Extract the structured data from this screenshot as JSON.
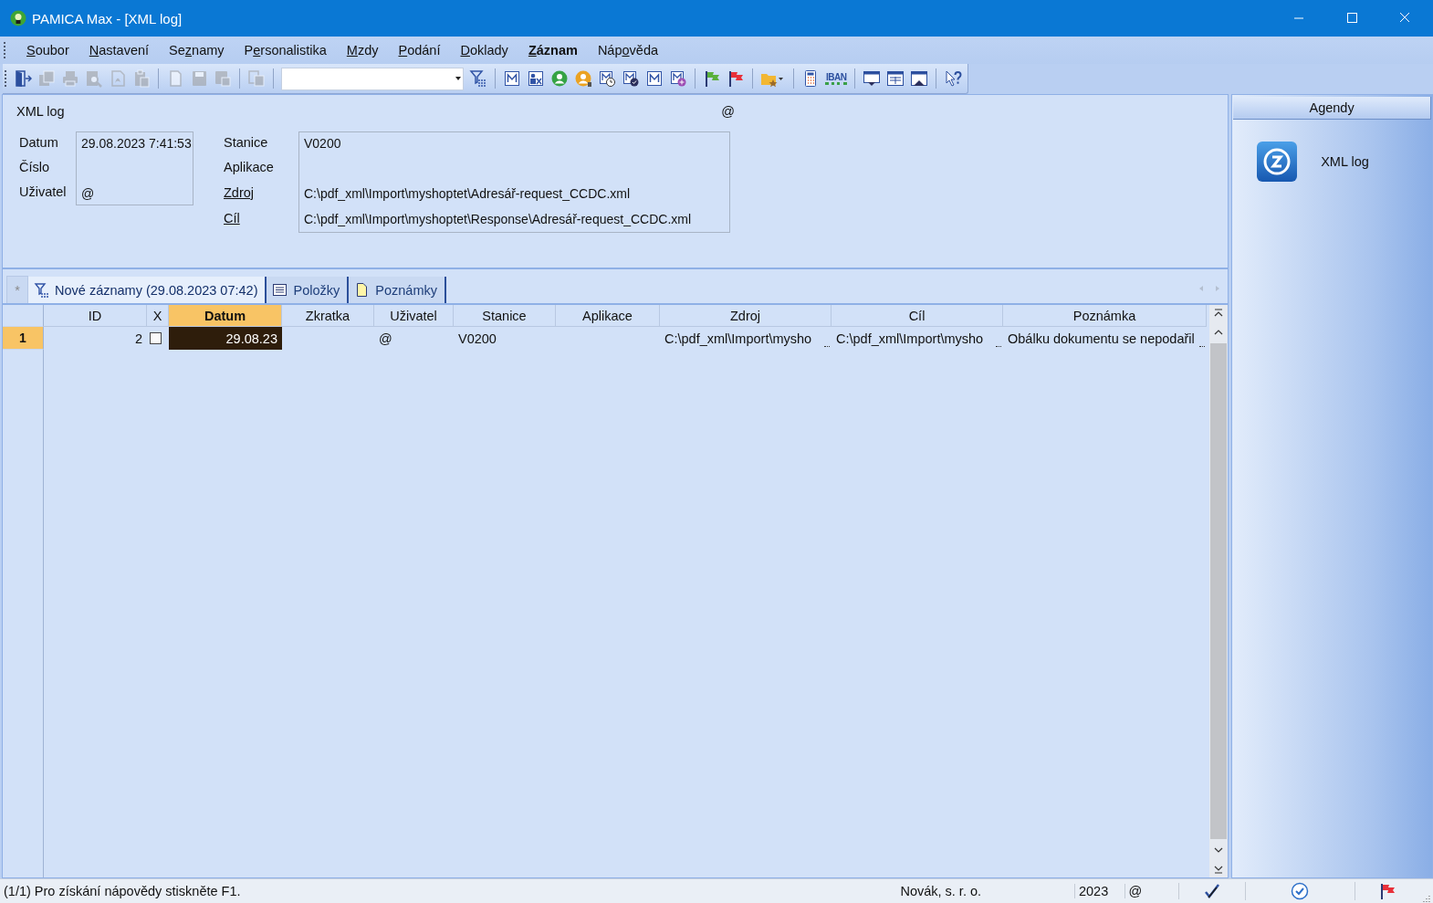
{
  "window": {
    "title": "PAMICA Max - [XML log]"
  },
  "menu": [
    {
      "key": "S",
      "post": "oubor",
      "emphasized": false
    },
    {
      "key": "N",
      "post": "astavení",
      "emphasized": false
    },
    {
      "pre": "Se",
      "key": "z",
      "post": "namy",
      "emphasized": false
    },
    {
      "pre": "P",
      "key": "e",
      "post": "rsonalistika",
      "emphasized": false
    },
    {
      "key": "M",
      "post": "zdy",
      "emphasized": false
    },
    {
      "key": "P",
      "post": "odání",
      "emphasized": false
    },
    {
      "key": "D",
      "post": "oklady",
      "emphasized": false
    },
    {
      "key": "Z",
      "post": "áznam",
      "emphasized": true
    },
    {
      "pre": "Náp",
      "key": "o",
      "post": "věda",
      "emphasized": false
    }
  ],
  "toolbar": [
    {
      "kind": "door",
      "disabled": false
    },
    {
      "kind": "copy",
      "disabled": true
    },
    {
      "kind": "printer",
      "disabled": true
    },
    {
      "kind": "preview",
      "disabled": true
    },
    {
      "kind": "pdf",
      "disabled": true
    },
    {
      "kind": "paste",
      "disabled": true
    },
    {
      "kind": "separator"
    },
    {
      "kind": "page",
      "disabled": true
    },
    {
      "kind": "save",
      "disabled": true
    },
    {
      "kind": "save-copy",
      "disabled": true
    },
    {
      "kind": "separator"
    },
    {
      "kind": "duplicate",
      "disabled": true
    },
    {
      "kind": "separator"
    },
    {
      "kind": "combo"
    },
    {
      "kind": "filter",
      "disabled": false
    },
    {
      "kind": "separator"
    },
    {
      "kind": "m",
      "disabled": false
    },
    {
      "kind": "person-x",
      "disabled": false
    },
    {
      "kind": "person-green",
      "disabled": false
    },
    {
      "kind": "person-orange",
      "disabled": false
    },
    {
      "kind": "m-clock",
      "disabled": false
    },
    {
      "kind": "m-check",
      "disabled": false
    },
    {
      "kind": "m",
      "disabled": false
    },
    {
      "kind": "m-plus",
      "disabled": false
    },
    {
      "kind": "separator"
    },
    {
      "kind": "flag-green",
      "disabled": false
    },
    {
      "kind": "flag-red",
      "disabled": false
    },
    {
      "kind": "separator"
    },
    {
      "kind": "folder-star",
      "disabled": false
    },
    {
      "kind": "separator"
    },
    {
      "kind": "calculator",
      "disabled": false
    },
    {
      "kind": "iban",
      "label": "IBAN",
      "disabled": false
    },
    {
      "kind": "separator"
    },
    {
      "kind": "window-down",
      "disabled": false
    },
    {
      "kind": "window",
      "disabled": false
    },
    {
      "kind": "window-up",
      "disabled": false
    },
    {
      "kind": "separator"
    },
    {
      "kind": "help",
      "disabled": false
    }
  ],
  "record": {
    "title": "XML log",
    "user_mark": "@",
    "left_fields": [
      {
        "label": "Datum",
        "value": "29.08.2023 7:41:53"
      },
      {
        "label": "Číslo"
      },
      {
        "label": "Uživatel",
        "value": "@"
      }
    ],
    "right_fields": [
      {
        "label": "Stanice",
        "value": "V0200",
        "link": false
      },
      {
        "label": "Aplikace",
        "link": false
      },
      {
        "label": "Zdroj",
        "value": "C:\\pdf_xml\\Import\\myshoptet\\Adresář-request_CCDC.xml",
        "link": true
      },
      {
        "label": "Cíl",
        "value": "C:\\pdf_xml\\Import\\myshoptet\\Response\\Adresář-request_CCDC.xml",
        "link": true
      }
    ]
  },
  "tabs": [
    {
      "kind": "new",
      "label": "*",
      "selected": false
    },
    {
      "kind": "filter",
      "label": "Nové záznamy (29.08.2023 07:42)",
      "selected": true
    },
    {
      "kind": "list",
      "label": "Položky",
      "selected": false
    },
    {
      "kind": "note",
      "label": "Poznámky",
      "selected": false
    }
  ],
  "table": {
    "columns": [
      {
        "label": "ID",
        "kind": "number",
        "selected": false
      },
      {
        "label": "X",
        "kind": "check",
        "selected": false
      },
      {
        "label": "Datum",
        "kind": "number",
        "selected": true
      },
      {
        "label": "Zkratka",
        "kind": "text",
        "selected": false
      },
      {
        "label": "Uživatel",
        "kind": "text",
        "selected": false
      },
      {
        "label": "Stanice",
        "kind": "text",
        "selected": false
      },
      {
        "label": "Aplikace",
        "kind": "text",
        "selected": false
      },
      {
        "label": "Zdroj",
        "kind": "text",
        "selected": false
      },
      {
        "label": "Cíl",
        "kind": "text",
        "selected": false
      },
      {
        "label": "Poznámka",
        "kind": "text",
        "selected": false
      }
    ],
    "rows": [
      {
        "number": "1",
        "selected": true,
        "cells": [
          {
            "text": "2"
          },
          {
            "checked": false
          },
          {
            "text": "29.08.23",
            "selected": true
          },
          {},
          {
            "text": "@"
          },
          {
            "text": "V0200"
          },
          {},
          {
            "text": "C:\\pdf_xml\\Import\\mysho",
            "truncated": true
          },
          {
            "text": "C:\\pdf_xml\\Import\\mysho",
            "truncated": true
          },
          {
            "text": "Obálku dokumentu se nepodařil",
            "truncated": true
          }
        ]
      }
    ]
  },
  "agendy": {
    "title": "Agendy",
    "items": [
      {
        "label": "XML log"
      }
    ]
  },
  "status_bar": {
    "message": "(1/1) Pro získání nápovědy stiskněte F1.",
    "company": "Novák, s. r. o.",
    "year": "2023",
    "user": "@"
  }
}
